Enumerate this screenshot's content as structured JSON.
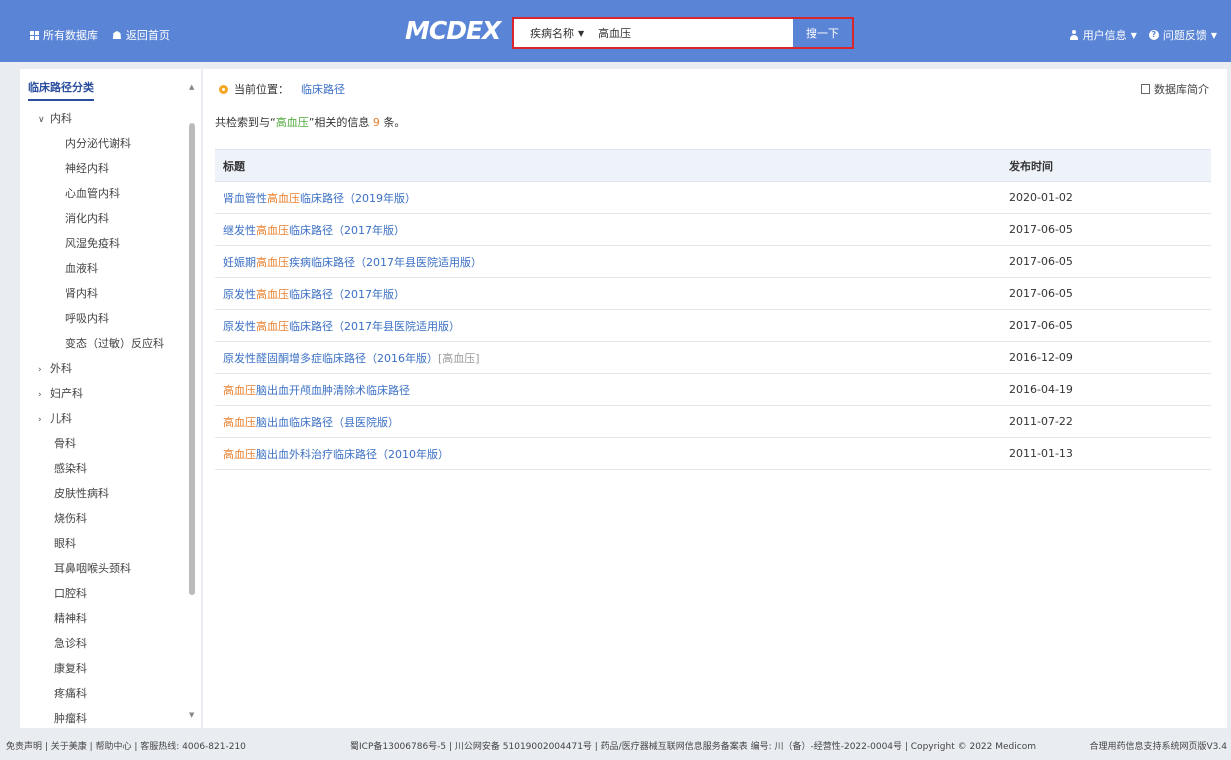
{
  "topbar": {
    "all_db": "所有数据库",
    "home": "返回首页",
    "logo": "MCDEX",
    "search_type": "疾病名称",
    "search_value": "高血压",
    "search_btn": "搜一下",
    "user_info": "用户信息",
    "feedback": "问题反馈"
  },
  "sidebar": {
    "title": "临床路径分类",
    "items": [
      {
        "label": "内科",
        "level": "top",
        "arrow": "v"
      },
      {
        "label": "内分泌代谢科",
        "level": "sub"
      },
      {
        "label": "神经内科",
        "level": "sub"
      },
      {
        "label": "心血管内科",
        "level": "sub"
      },
      {
        "label": "消化内科",
        "level": "sub"
      },
      {
        "label": "风湿免疫科",
        "level": "sub"
      },
      {
        "label": "血液科",
        "level": "sub"
      },
      {
        "label": "肾内科",
        "level": "sub"
      },
      {
        "label": "呼吸内科",
        "level": "sub"
      },
      {
        "label": "变态（过敏）反应科",
        "level": "sub"
      },
      {
        "label": "外科",
        "level": "top",
        "arrow": ">"
      },
      {
        "label": "妇产科",
        "level": "top",
        "arrow": ">"
      },
      {
        "label": "儿科",
        "level": "top",
        "arrow": ">"
      },
      {
        "label": "骨科",
        "level": "plain"
      },
      {
        "label": "感染科",
        "level": "plain"
      },
      {
        "label": "皮肤性病科",
        "level": "plain"
      },
      {
        "label": "烧伤科",
        "level": "plain"
      },
      {
        "label": "眼科",
        "level": "plain"
      },
      {
        "label": "耳鼻咽喉头颈科",
        "level": "plain"
      },
      {
        "label": "口腔科",
        "level": "plain"
      },
      {
        "label": "精神科",
        "level": "plain"
      },
      {
        "label": "急诊科",
        "level": "plain"
      },
      {
        "label": "康复科",
        "level": "plain"
      },
      {
        "label": "疼痛科",
        "level": "plain"
      },
      {
        "label": "肿瘤科",
        "level": "plain"
      }
    ]
  },
  "main": {
    "crumb_label": "当前位置：",
    "crumb_link": "临床路径",
    "db_intro": "数据库简介",
    "summary_pre": "共检索到与“",
    "summary_kw": "高血压",
    "summary_mid": "”相关的信息",
    "summary_count": "9",
    "summary_post": "条。",
    "col_title": "标题",
    "col_date": "发布时间",
    "rows": [
      {
        "pre": "肾血管性",
        "hl": "高血压",
        "post": "临床路径（2019年版）",
        "extra": "",
        "date": "2020-01-02"
      },
      {
        "pre": "继发性",
        "hl": "高血压",
        "post": "临床路径（2017年版）",
        "extra": "",
        "date": "2017-06-05"
      },
      {
        "pre": "妊娠期",
        "hl": "高血压",
        "post": "疾病临床路径（2017年县医院适用版）",
        "extra": "",
        "date": "2017-06-05"
      },
      {
        "pre": "原发性",
        "hl": "高血压",
        "post": "临床路径（2017年版）",
        "extra": "",
        "date": "2017-06-05"
      },
      {
        "pre": "原发性",
        "hl": "高血压",
        "post": "临床路径（2017年县医院适用版）",
        "extra": "",
        "date": "2017-06-05"
      },
      {
        "pre": "原发性醛固酮增多症临床路径（2016年版）",
        "hl": "",
        "post": "",
        "extra": "[高血压]",
        "date": "2016-12-09"
      },
      {
        "pre": "",
        "hl": "高血压",
        "post": "脑出血开颅血肿清除术临床路径",
        "extra": "",
        "date": "2016-04-19"
      },
      {
        "pre": "",
        "hl": "高血压",
        "post": "脑出血临床路径（县医院版）",
        "extra": "",
        "date": "2011-07-22"
      },
      {
        "pre": "",
        "hl": "高血压",
        "post": "脑出血外科治疗临床路径（2010年版）",
        "extra": "",
        "date": "2011-01-13"
      }
    ]
  },
  "footer": {
    "left": "免责声明 | 关于美康 | 帮助中心 | 客服热线: 4006-821-210",
    "mid": "蜀ICP备13006786号-5 | 川公网安备 51019002004471号 | 药品/医疗器械互联网信息服务备案表 编号: 川（备）-经营性-2022-0004号 | Copyright © 2022 Medicom",
    "right": "合理用药信息支持系统网页版V3.4"
  },
  "colors": {
    "topbar": "#5a84d6",
    "highlight": "#e87e2a",
    "link": "#3a6fc4",
    "keyword": "#4ea83a",
    "search_border": "#d9262d"
  }
}
